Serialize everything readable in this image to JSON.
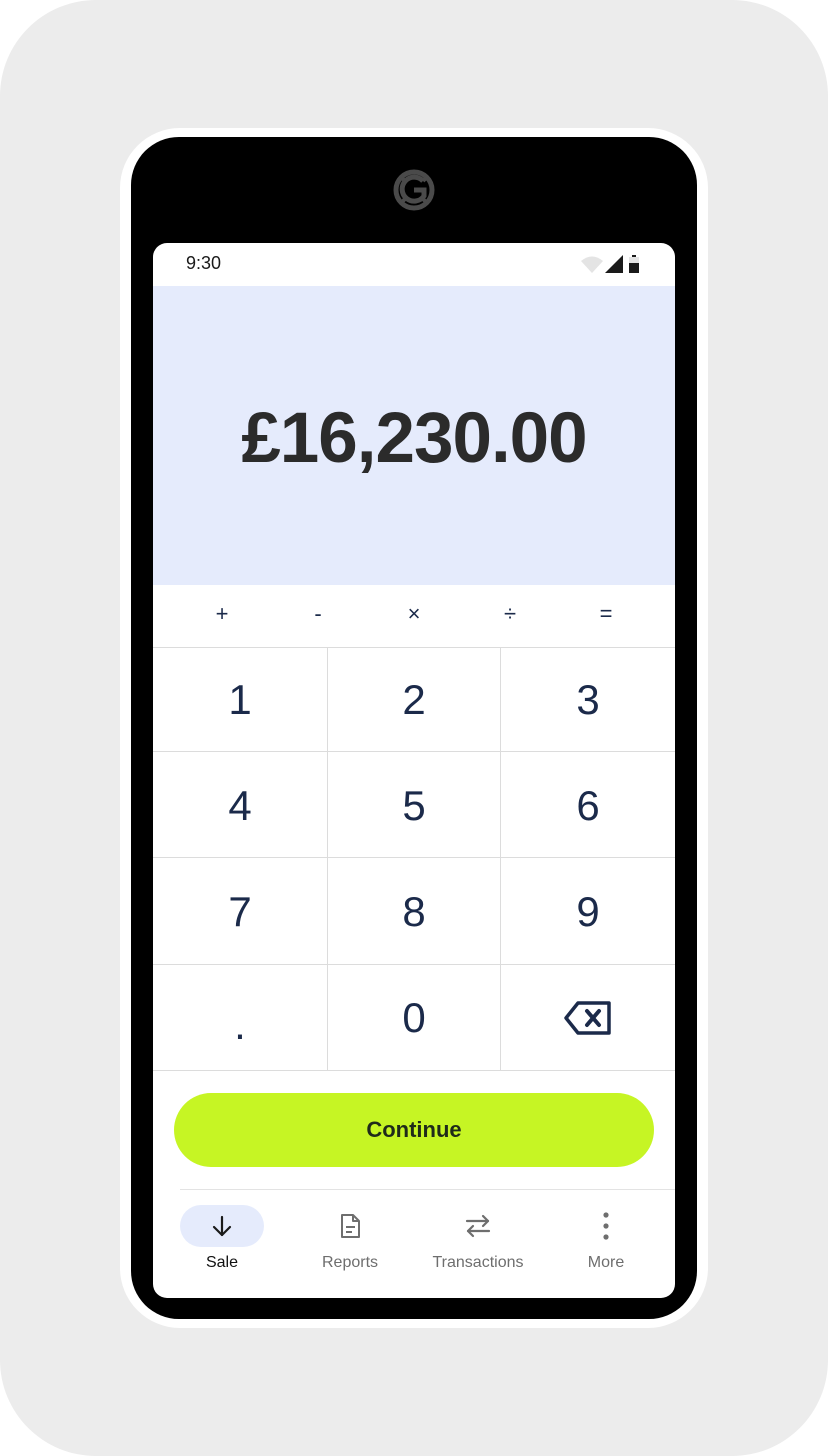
{
  "status_bar": {
    "time": "9:30",
    "icons": [
      "wifi-icon",
      "cellular-signal-icon",
      "battery-icon"
    ]
  },
  "amount": {
    "display": "£16,230.00"
  },
  "operators": [
    "+",
    "-",
    "×",
    "÷",
    "="
  ],
  "keypad": {
    "keys": [
      "1",
      "2",
      "3",
      "4",
      "5",
      "6",
      "7",
      "8",
      "9",
      ".",
      "0"
    ],
    "backspace_icon": "backspace-icon"
  },
  "continue_label": "Continue",
  "nav": {
    "items": [
      {
        "label": "Sale",
        "icon": "arrow-down-icon",
        "active": true
      },
      {
        "label": "Reports",
        "icon": "document-icon",
        "active": false
      },
      {
        "label": "Transactions",
        "icon": "swap-arrows-icon",
        "active": false
      },
      {
        "label": "More",
        "icon": "more-vertical-icon",
        "active": false
      }
    ]
  },
  "colors": {
    "accent": "#c6f524",
    "amount_background": "#e5ebfc",
    "active_nav_pill": "#e5ebfc",
    "key_text": "#1b2a4a"
  }
}
